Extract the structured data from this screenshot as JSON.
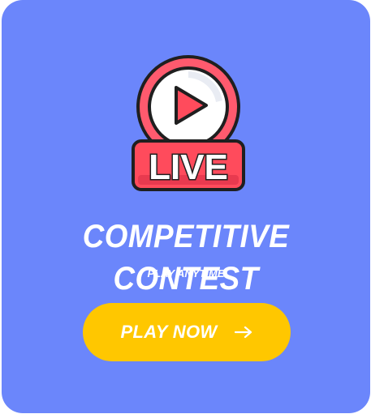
{
  "card": {
    "background_color": "#6b86fb",
    "badge": {
      "icon": "live-play-icon",
      "text": "LIVE",
      "accent_color": "#ff4b5c"
    },
    "title": "COMPETITIVE CONTEST",
    "subtitle": "PLAY ANYTIME",
    "cta": {
      "label": "PLAY NOW",
      "icon": "arrow-right-icon",
      "color": "#ffc700"
    }
  }
}
